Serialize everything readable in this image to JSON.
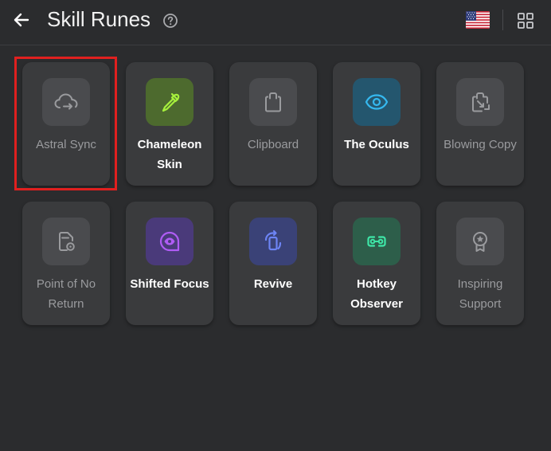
{
  "header": {
    "title": "Skill Runes",
    "icons": {
      "back": "arrow-left-icon",
      "help": "help-circle-icon",
      "flag": "us-flag-icon",
      "grid": "grid-view-icon"
    }
  },
  "selected_card": "Astral Sync",
  "cards": [
    {
      "label": "Astral Sync",
      "icon": "cloud-sync-icon",
      "tile_color": "#4a4b4e",
      "icon_color": "#9a9b9e",
      "style": "dim"
    },
    {
      "label": "Chameleon Skin",
      "icon": "eyedropper-icon",
      "tile_color": "#4d6a2e",
      "icon_color": "#a6f03c",
      "style": "bright"
    },
    {
      "label": "Clipboard",
      "icon": "clipboard-icon",
      "tile_color": "#4a4b4e",
      "icon_color": "#9a9b9e",
      "style": "dim"
    },
    {
      "label": "The Oculus",
      "icon": "eye-icon",
      "tile_color": "#24566e",
      "icon_color": "#35b8ef",
      "style": "bright"
    },
    {
      "label": "Blowing Copy",
      "icon": "copy-cut-icon",
      "tile_color": "#4a4b4e",
      "icon_color": "#9a9b9e",
      "style": "dim"
    },
    {
      "label": "Point of No Return",
      "icon": "file-record-icon",
      "tile_color": "#4a4b4e",
      "icon_color": "#9a9b9e",
      "style": "dim"
    },
    {
      "label": "Shifted Focus",
      "icon": "focus-eye-icon",
      "tile_color": "#4a3a7a",
      "icon_color": "#b05cf5",
      "style": "bright"
    },
    {
      "label": "Revive",
      "icon": "phone-rotate-icon",
      "tile_color": "#3a4277",
      "icon_color": "#6d84f4",
      "style": "bright"
    },
    {
      "label": "Hotkey Observer",
      "icon": "link-keys-icon",
      "tile_color": "#2d5e4a",
      "icon_color": "#3ee6a7",
      "style": "bright"
    },
    {
      "label": "Inspiring Support",
      "icon": "award-ribbon-icon",
      "tile_color": "#4a4b4e",
      "icon_color": "#9a9b9e",
      "style": "dim"
    }
  ]
}
